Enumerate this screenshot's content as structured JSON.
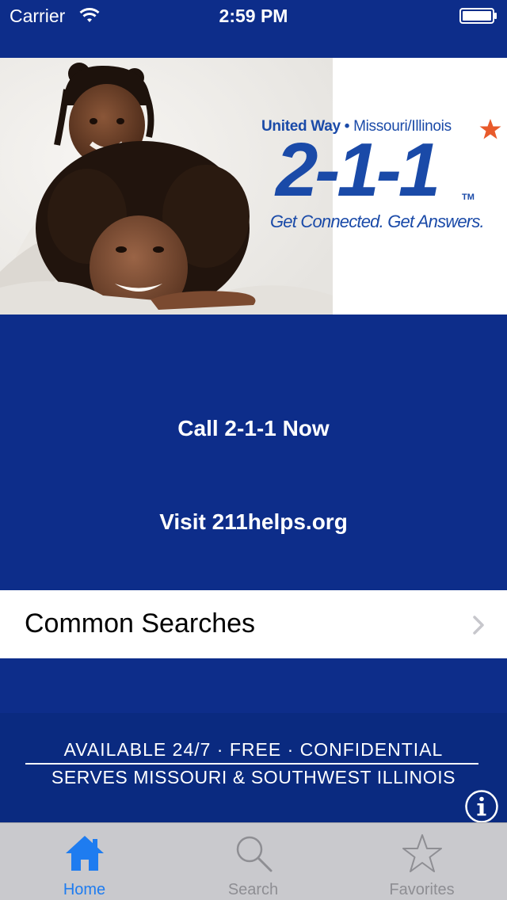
{
  "status_bar": {
    "carrier": "Carrier",
    "time": "2:59 PM",
    "wifi_icon": "wifi-icon",
    "battery_icon": "battery-icon"
  },
  "hero": {
    "org_name": "United Way",
    "separator": "•",
    "region": "Missouri/Illinois",
    "number": "2-1-1",
    "trademark": "TM",
    "tagline": "Get Connected. Get Answers.",
    "star_color": "#e85a2b",
    "brand_color": "#1a4aa8"
  },
  "actions": {
    "call_label": "Call 2-1-1 Now",
    "visit_label": "Visit 211helps.org"
  },
  "common_searches": {
    "label": "Common Searches",
    "chevron_icon": "chevron-right-icon"
  },
  "footer": {
    "line1": "AVAILABLE 24/7  ·  FREE  ·  CONFIDENTIAL",
    "line2": "SERVES MISSOURI & SOUTHWEST ILLINOIS",
    "info_icon": "info-icon"
  },
  "tab_bar": {
    "tabs": [
      {
        "label": "Home",
        "icon": "home-icon",
        "selected": true
      },
      {
        "label": "Search",
        "icon": "search-icon",
        "selected": false
      },
      {
        "label": "Favorites",
        "icon": "star-icon",
        "selected": false
      }
    ]
  },
  "colors": {
    "background": "#0d2d8a",
    "tab_selected": "#1e7cf0",
    "tab_unselected": "#8e8e93"
  }
}
